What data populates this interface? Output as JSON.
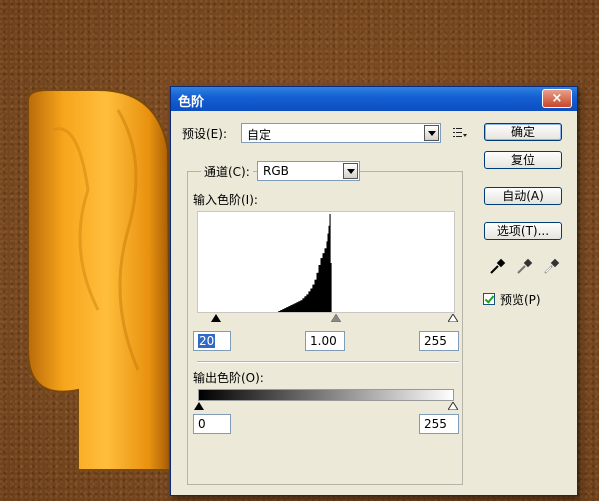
{
  "window": {
    "title": "色阶",
    "close_glyph": "×"
  },
  "preset": {
    "label": "预设(E):",
    "value": "自定"
  },
  "channel": {
    "label": "通道(C):",
    "value": "RGB"
  },
  "input_levels": {
    "label": "输入色阶(I):",
    "black": "20",
    "gamma": "1.00",
    "white": "255"
  },
  "output_levels": {
    "label": "输出色阶(O):",
    "black": "0",
    "white": "255"
  },
  "buttons": {
    "ok": "确定",
    "reset": "复位",
    "auto": "自动(A)",
    "options": "选项(T)..."
  },
  "preview": {
    "label": "预览(P)",
    "checked": true
  },
  "icons": [
    "preset-menu-icon",
    "black-eyedropper-icon",
    "gray-eyedropper-icon",
    "white-eyedropper-icon"
  ],
  "colors": {
    "title_bar": "#1560d4",
    "dialog_bg": "#ece9d8",
    "close_button": "#c8462a",
    "selection": "#316ac5"
  },
  "chart_data": {
    "type": "bar",
    "x_range": [
      0,
      255
    ],
    "x": [
      80,
      82,
      84,
      86,
      88,
      90,
      92,
      94,
      96,
      98,
      100,
      102,
      104,
      106,
      108,
      110,
      112,
      114,
      116,
      118,
      120,
      122,
      124,
      126,
      128,
      129,
      130,
      131,
      132
    ],
    "values": [
      1,
      2,
      3,
      4,
      5,
      6,
      7,
      8,
      9,
      10,
      11,
      12,
      14,
      16,
      18,
      21,
      24,
      28,
      33,
      40,
      48,
      55,
      60,
      65,
      72,
      80,
      88,
      100,
      50
    ]
  }
}
